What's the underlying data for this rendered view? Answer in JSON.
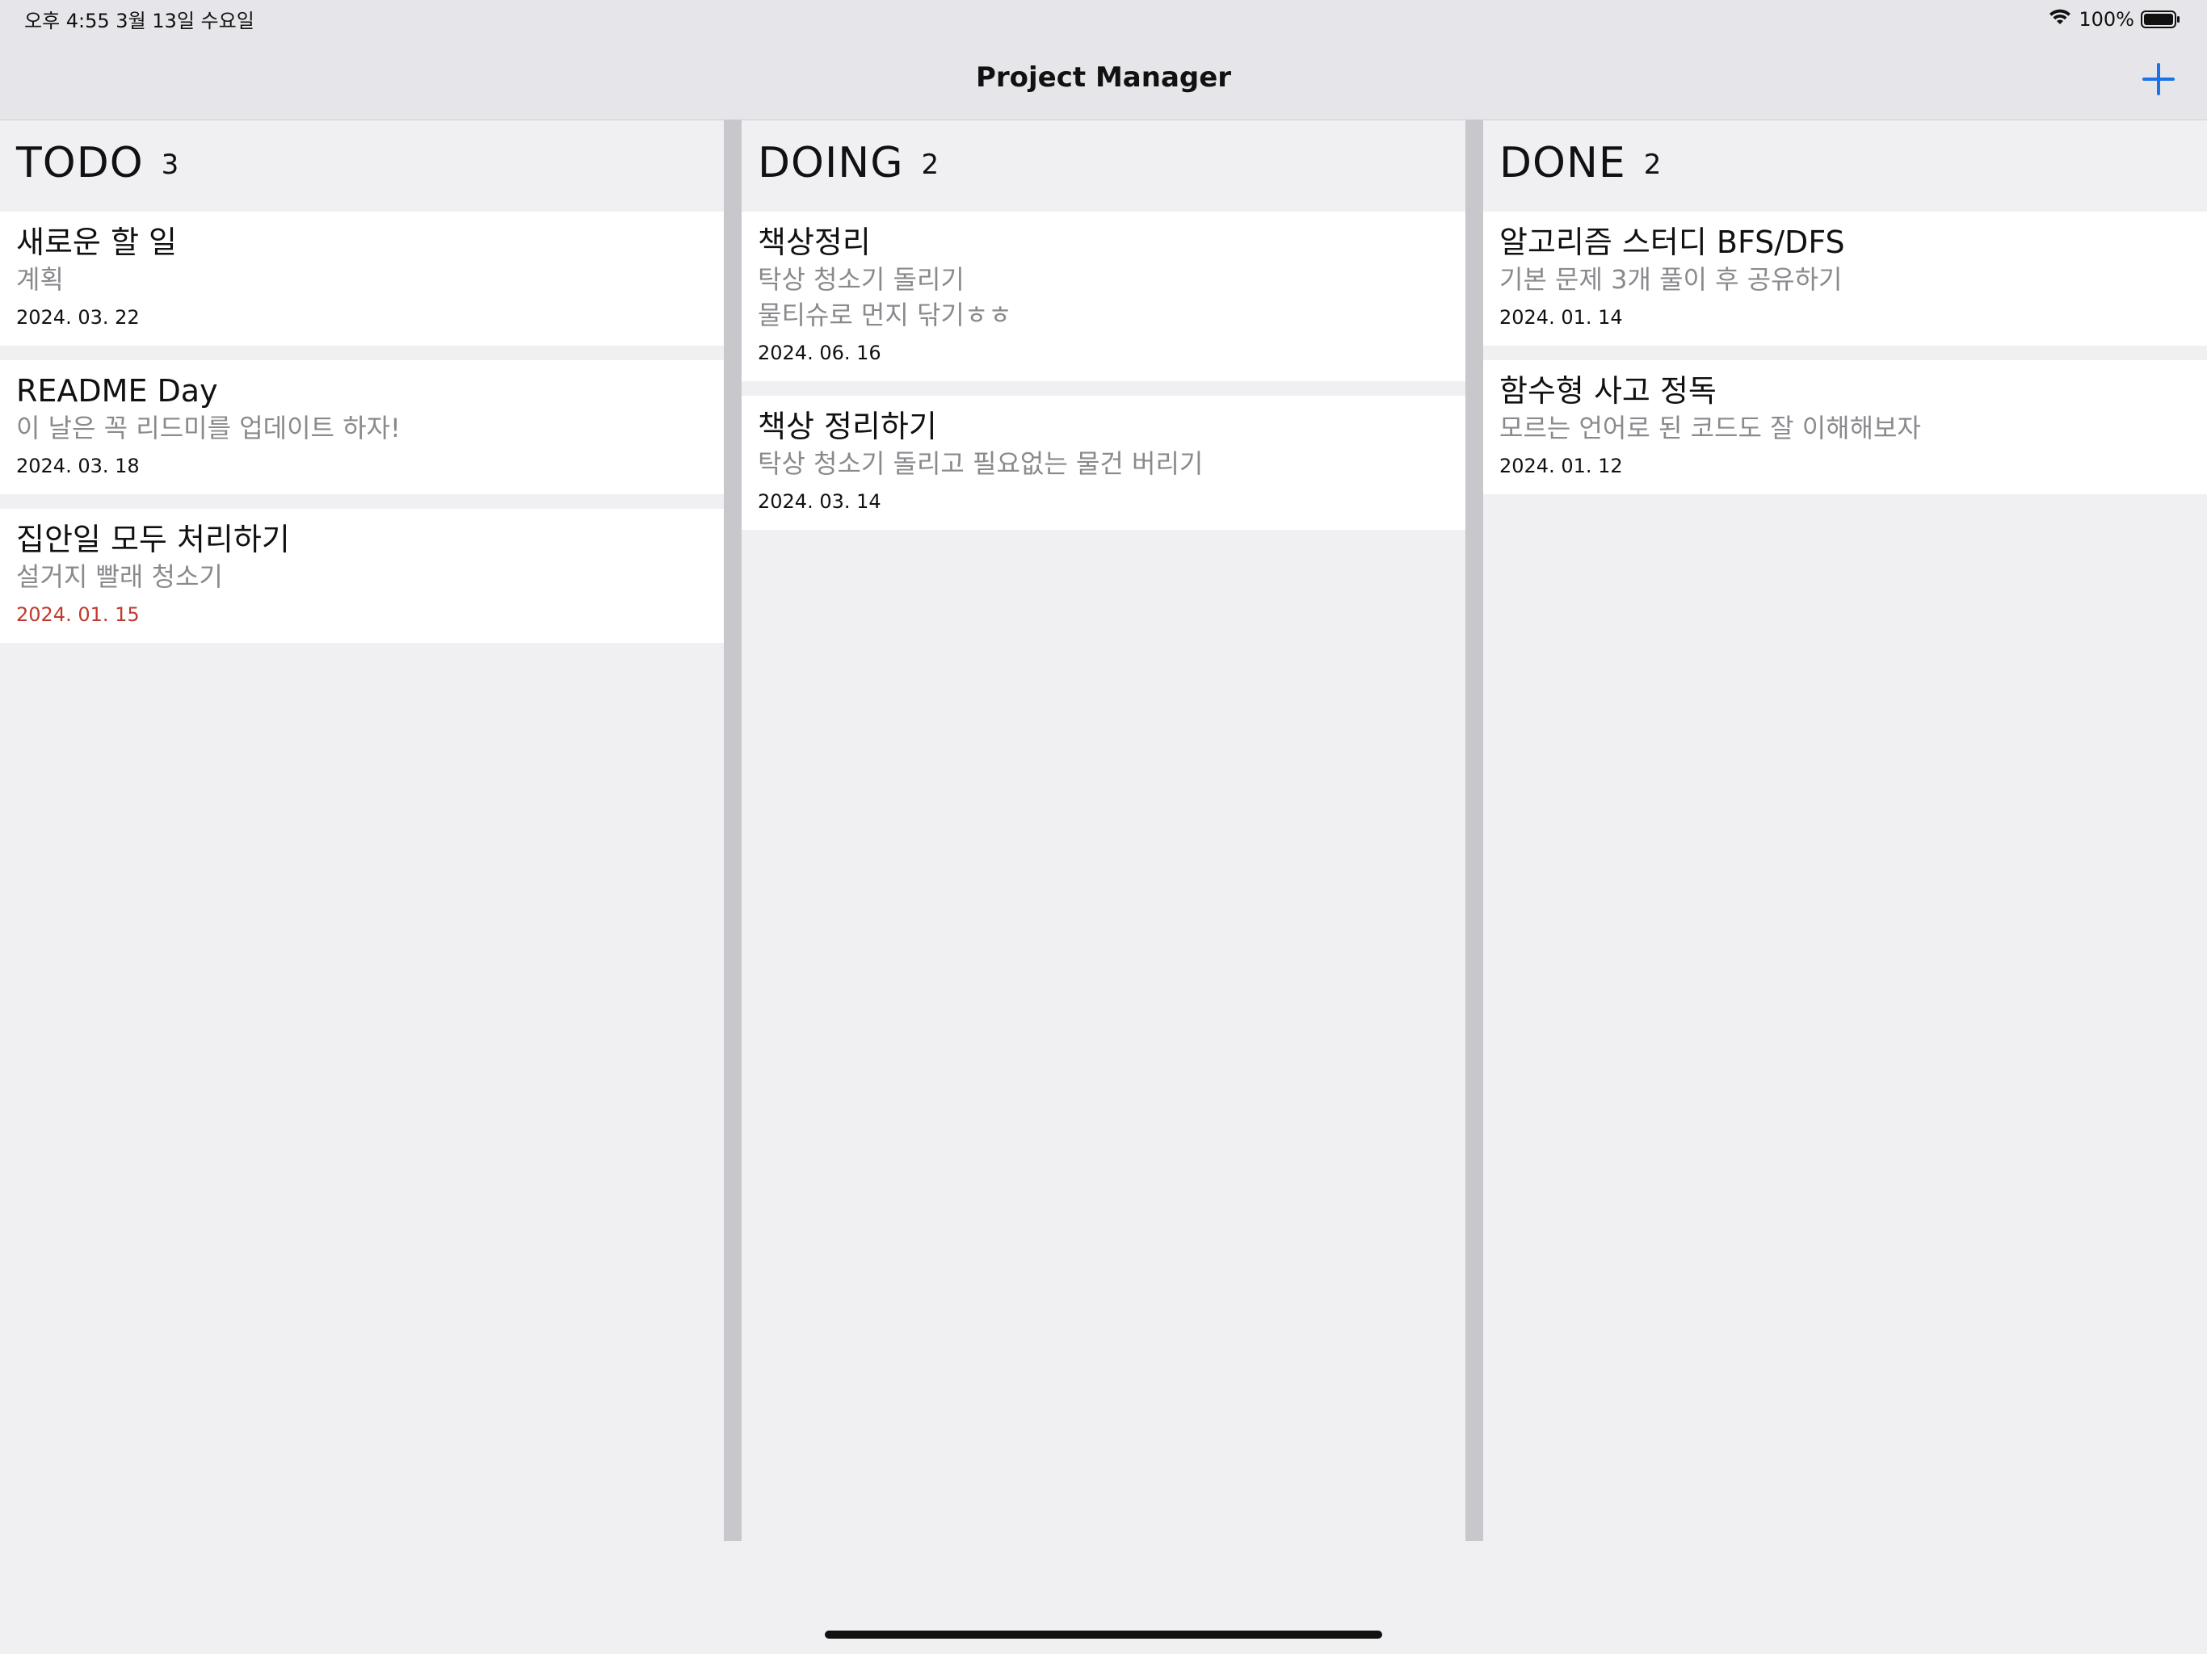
{
  "status_bar": {
    "time_date": "오후 4:55   3월 13일 수요일",
    "battery": "100%"
  },
  "nav": {
    "title": "Project Manager",
    "add_icon": "plus-icon",
    "accent_color": "#1a73e8"
  },
  "columns": [
    {
      "title": "TODO",
      "count": "3",
      "cards": [
        {
          "title": "새로운 할 일",
          "body": "계획",
          "date": "2024. 03. 22",
          "overdue": false
        },
        {
          "title": "README Day",
          "body": "이 날은 꼭 리드미를 업데이트 하자!",
          "date": "2024. 03. 18",
          "overdue": false
        },
        {
          "title": "집안일 모두 처리하기",
          "body": "설거지 빨래 청소기",
          "date": "2024. 01. 15",
          "overdue": true
        }
      ]
    },
    {
      "title": "DOING",
      "count": "2",
      "cards": [
        {
          "title": "책상정리",
          "body": "탁상 청소기 돌리기\n물티슈로 먼지 닦기ㅎㅎ",
          "date": "2024. 06. 16",
          "overdue": false
        },
        {
          "title": "책상 정리하기",
          "body": "탁상 청소기 돌리고 필요없는 물건 버리기",
          "date": "2024. 03. 14",
          "overdue": false
        }
      ]
    },
    {
      "title": "DONE",
      "count": "2",
      "cards": [
        {
          "title": "알고리즘 스터디 BFS/DFS",
          "body": "기본 문제 3개 풀이 후 공유하기",
          "date": "2024. 01. 14",
          "overdue": false
        },
        {
          "title": "함수형 사고 정독",
          "body": "모르는 언어로 된 코드도 잘 이해해보자",
          "date": "2024. 01. 12",
          "overdue": false
        }
      ]
    }
  ],
  "colors": {
    "overdue": "#c0392b",
    "secondary_text": "#8a8a8e"
  }
}
